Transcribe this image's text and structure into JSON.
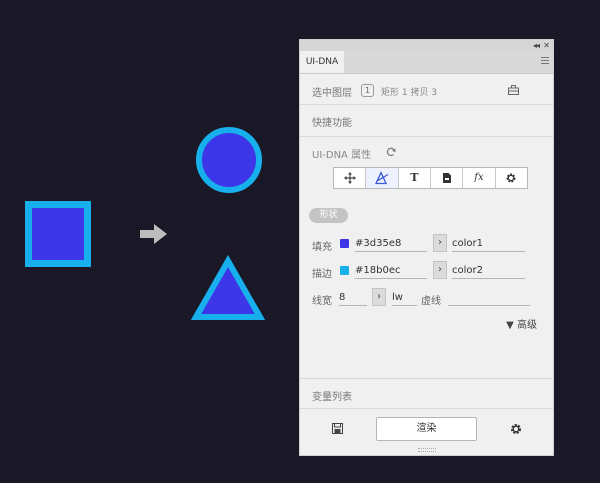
{
  "colors": {
    "background": "#1a1726",
    "fill": "#3d35e8",
    "stroke": "#18b0ec",
    "arrow": "#bdbdbd"
  },
  "panel": {
    "tab_label": "UI-DNA",
    "selection": {
      "label": "选中图层",
      "count": "1",
      "detail": "矩形 1 拷贝 3"
    },
    "shortcuts_title": "快捷功能",
    "properties_title": "UI-DNA 属性",
    "toolbar_icons": [
      "move-icon",
      "style-icon",
      "text-icon",
      "file-icon",
      "fx-icon",
      "gear-icon"
    ],
    "toolbar_fx_label": "fx",
    "toolbar_text_label": "T",
    "shape_pill": "形状",
    "fill": {
      "label": "填充",
      "hex": "#3d35e8",
      "variable": "color1"
    },
    "stroke": {
      "label": "描边",
      "hex": "#18b0ec",
      "variable": "color2"
    },
    "line_width": {
      "label": "线宽",
      "value": "8",
      "unit": "lw",
      "dash_label": "虚线",
      "dash_value": ""
    },
    "advanced_label": "▼ 高级",
    "variables_title": "变量列表",
    "render_label": "渲染"
  }
}
